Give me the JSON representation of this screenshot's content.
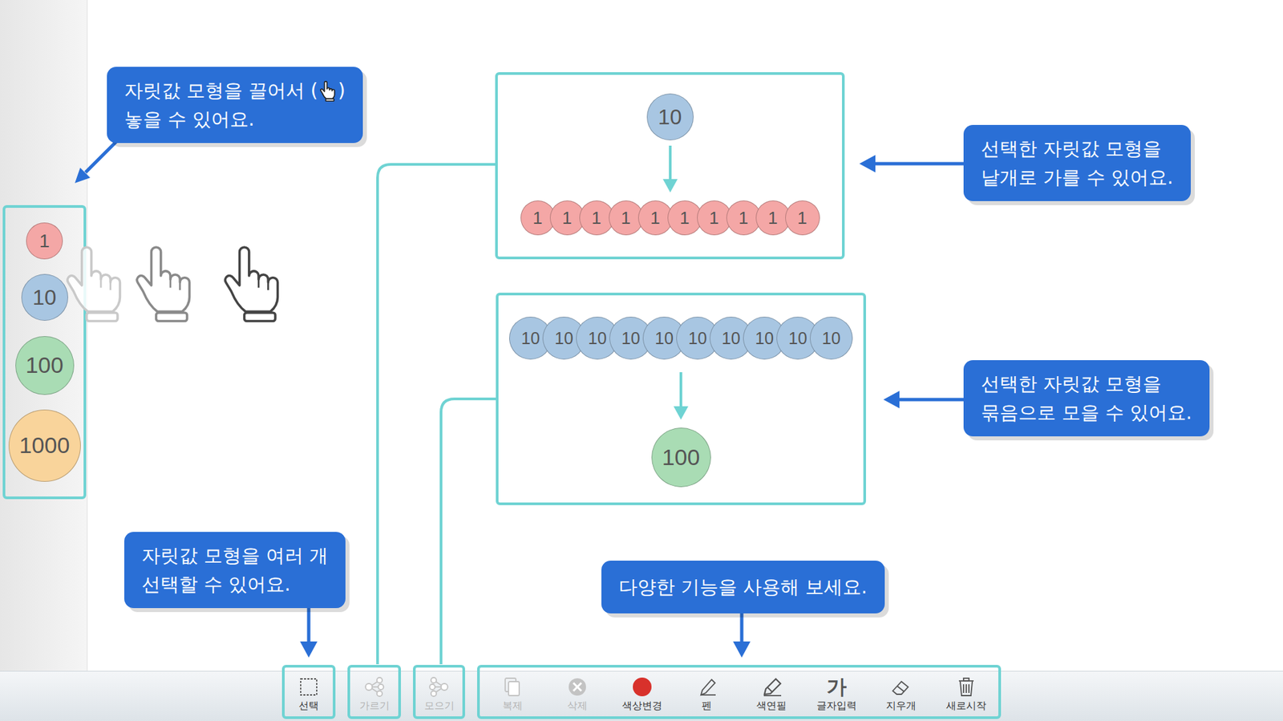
{
  "palette": [
    {
      "value": "1",
      "color": "#f4a7a6"
    },
    {
      "value": "10",
      "color": "#a8c6e2"
    },
    {
      "value": "100",
      "color": "#a9dcb4"
    },
    {
      "value": "1000",
      "color": "#f9d49b"
    }
  ],
  "callouts": [
    {
      "lines": [
        [
          "자릿값 모형을 끌어서 (",
          ")"
        ],
        [
          "놓을 수 있어요."
        ]
      ]
    },
    {
      "lines": [
        [
          "선택한 자릿값 모형을"
        ],
        [
          "낱개로 가를 수 있어요."
        ]
      ]
    },
    {
      "lines": [
        [
          "선택한 자릿값 모형을"
        ],
        [
          "묶음으로 모을 수 있어요."
        ]
      ]
    },
    {
      "lines": [
        [
          "자릿값 모형을 여러 개"
        ],
        [
          "선택할 수 있어요."
        ]
      ]
    },
    {
      "lines": [
        [
          "다양한 기능을 사용해 보세요."
        ]
      ]
    }
  ],
  "split_demo": {
    "source": "10",
    "pieces": [
      "1",
      "1",
      "1",
      "1",
      "1",
      "1",
      "1",
      "1",
      "1",
      "1"
    ]
  },
  "merge_demo": {
    "sources": [
      "10",
      "10",
      "10",
      "10",
      "10",
      "10",
      "10",
      "10",
      "10",
      "10"
    ],
    "result": "100"
  },
  "toolbar": {
    "groups": [
      {
        "tools": [
          {
            "label": "선택",
            "kind": "select",
            "disabled": false
          }
        ]
      },
      {
        "tools": [
          {
            "label": "가르기",
            "kind": "split",
            "disabled": true
          }
        ]
      },
      {
        "tools": [
          {
            "label": "모으기",
            "kind": "merge",
            "disabled": true
          }
        ]
      },
      {
        "tools": [
          {
            "label": "복제",
            "kind": "copy",
            "disabled": true
          },
          {
            "label": "삭제",
            "kind": "delete",
            "disabled": true
          },
          {
            "label": "색상변경",
            "kind": "color",
            "disabled": false
          },
          {
            "label": "펜",
            "kind": "pen",
            "disabled": false
          },
          {
            "label": "색연필",
            "kind": "crayon",
            "disabled": false
          },
          {
            "label": "글자입력",
            "kind": "text",
            "disabled": false,
            "glyph": "가"
          },
          {
            "label": "지우개",
            "kind": "eraser",
            "disabled": false
          },
          {
            "label": "새로시작",
            "kind": "reset",
            "disabled": false
          }
        ]
      }
    ]
  }
}
